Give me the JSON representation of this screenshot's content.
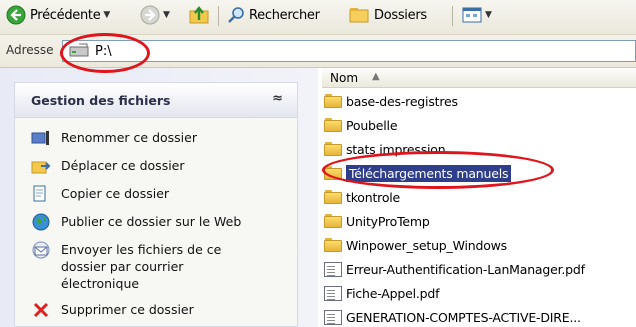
{
  "toolbar": {
    "back_label": "Précédente",
    "search_label": "Rechercher",
    "folders_label": "Dossiers"
  },
  "address": {
    "label": "Adresse",
    "value": "P:\\"
  },
  "tasks_panel": {
    "title": "Gestion des fichiers",
    "collapse_glyph": "≈",
    "tasks": [
      {
        "label": "Renommer ce dossier",
        "icon": "rename-icon"
      },
      {
        "label": "Déplacer ce dossier",
        "icon": "move-icon"
      },
      {
        "label": "Copier ce dossier",
        "icon": "copy-icon"
      },
      {
        "label": "Publier ce dossier sur le Web",
        "icon": "globe-icon"
      },
      {
        "label": "Envoyer les fichiers de ce dossier par courrier électronique",
        "icon": "mail-icon"
      },
      {
        "label": "Supprimer ce dossier",
        "icon": "delete-icon"
      }
    ]
  },
  "file_list": {
    "column_name": "Nom",
    "sort_indicator": "▲",
    "items": [
      {
        "name": "base-des-registres",
        "type": "folder"
      },
      {
        "name": "Poubelle",
        "type": "folder"
      },
      {
        "name": "stats impression",
        "type": "folder"
      },
      {
        "name": "Téléchargements manuels",
        "type": "folder",
        "selected": true
      },
      {
        "name": "tkontrole",
        "type": "folder"
      },
      {
        "name": "UnityProTemp",
        "type": "folder"
      },
      {
        "name": "Winpower_setup_Windows",
        "type": "folder"
      },
      {
        "name": "Erreur-Authentification-LanManager.pdf",
        "type": "pdf"
      },
      {
        "name": "Fiche-Appel.pdf",
        "type": "pdf"
      },
      {
        "name": "GENERATION-COMPTES-ACTIVE-DIRE...",
        "type": "pdf"
      }
    ]
  },
  "colors": {
    "selection": "#2f3e8a",
    "annotation": "#e0141b"
  }
}
